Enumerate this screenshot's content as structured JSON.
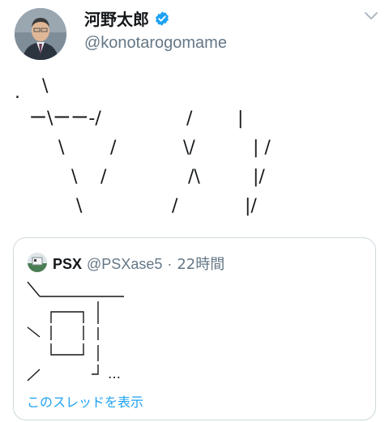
{
  "author": {
    "display_name": "河野太郎",
    "handle": "@konotarogomame",
    "avatar": "politician-portrait",
    "verified_icon": "verified-badge-icon"
  },
  "tweet": {
    "ascii_art": {
      "dot": ".",
      "backslash": "\\",
      "slash": "/",
      "pipe": "|",
      "dash_row": "ー\\ーー-/",
      "v_join": "\\/",
      "lambda": "/\\",
      "pipe_slash": "|/",
      "pipe_space_slash": "| /"
    }
  },
  "quote": {
    "name": "PSX",
    "handle": "@PSXase5",
    "separator": "·",
    "time": "22時間",
    "ellipsis": "…",
    "show_thread": "このスレッドを表示"
  },
  "colors": {
    "link": "#1da1f2",
    "muted": "#657786",
    "border": "#cfd9de",
    "verified": "#1da1f2"
  }
}
